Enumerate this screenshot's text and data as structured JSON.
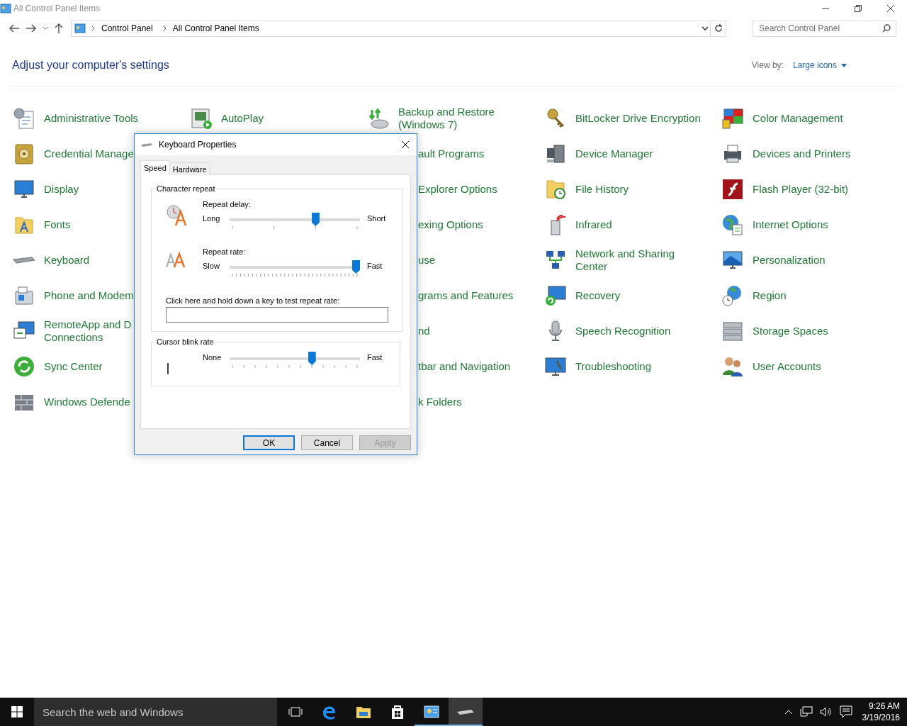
{
  "window": {
    "title": "All Control Panel Items"
  },
  "address": {
    "crumbs": [
      "Control Panel",
      "All Control Panel Items"
    ]
  },
  "search": {
    "placeholder": "Search Control Panel"
  },
  "heading": "Adjust your computer's settings",
  "view_by": {
    "label": "View by:",
    "value": "Large icons"
  },
  "columns": [
    {
      "items": [
        {
          "label": "Administrative Tools",
          "kind": "full"
        },
        {
          "label": "Credential Manage",
          "kind": "full"
        },
        {
          "label": "Display",
          "kind": "full"
        },
        {
          "label": "Fonts",
          "kind": "full"
        },
        {
          "label": "Keyboard",
          "kind": "full"
        },
        {
          "label": "Phone and Modem",
          "kind": "full"
        },
        {
          "label": "RemoteApp and D\nConnections",
          "kind": "full"
        },
        {
          "label": "Sync Center",
          "kind": "full"
        },
        {
          "label": "Windows Defende",
          "kind": "full"
        }
      ]
    },
    {
      "items": [
        {
          "label": "AutoPlay",
          "kind": "full"
        }
      ]
    },
    {
      "items": [
        {
          "label": "Backup and Restore\n(Windows 7)",
          "kind": "full"
        },
        {
          "label": "ault Programs",
          "kind": "clipped"
        },
        {
          "label": "Explorer Options",
          "kind": "clipped"
        },
        {
          "label": "exing Options",
          "kind": "clipped"
        },
        {
          "label": "use",
          "kind": "clipped"
        },
        {
          "label": "grams and Features",
          "kind": "clipped"
        },
        {
          "label": "nd",
          "kind": "clipped"
        },
        {
          "label": "tbar and Navigation",
          "kind": "clipped"
        },
        {
          "label": "k Folders",
          "kind": "clipped"
        }
      ]
    },
    {
      "items": [
        {
          "label": "BitLocker Drive Encryption",
          "kind": "full"
        },
        {
          "label": "Device Manager",
          "kind": "full"
        },
        {
          "label": "File History",
          "kind": "full"
        },
        {
          "label": "Infrared",
          "kind": "full"
        },
        {
          "label": "Network and Sharing\nCenter",
          "kind": "full"
        },
        {
          "label": "Recovery",
          "kind": "full"
        },
        {
          "label": "Speech Recognition",
          "kind": "full"
        },
        {
          "label": "Troubleshooting",
          "kind": "full"
        }
      ]
    },
    {
      "items": [
        {
          "label": "Color Management",
          "kind": "full"
        },
        {
          "label": "Devices and Printers",
          "kind": "full"
        },
        {
          "label": "Flash Player (32-bit)",
          "kind": "full"
        },
        {
          "label": "Internet Options",
          "kind": "full"
        },
        {
          "label": "Personalization",
          "kind": "full"
        },
        {
          "label": "Region",
          "kind": "full"
        },
        {
          "label": "Storage Spaces",
          "kind": "full"
        },
        {
          "label": "User Accounts",
          "kind": "full"
        }
      ]
    }
  ],
  "dialog": {
    "title": "Keyboard Properties",
    "tabs": [
      {
        "label": "Speed",
        "selected": true
      },
      {
        "label": "Hardware",
        "selected": false
      }
    ],
    "groups": [
      {
        "title": "Character repeat",
        "sliders": [
          {
            "label": "Repeat delay:",
            "min": "Long",
            "max": "Short",
            "level": 0.67
          },
          {
            "label": "Repeat rate:",
            "min": "Slow",
            "max": "Fast",
            "level": 1
          }
        ],
        "test_field": {
          "label": "Click here and hold down a key to test repeat rate:"
        }
      },
      {
        "title": "Cursor blink rate",
        "sliders": [
          {
            "min": "None",
            "max": "Fast",
            "level": 0.64
          }
        ]
      }
    ],
    "buttons": [
      {
        "label": "OK",
        "default": true,
        "disabled": false
      },
      {
        "label": "Cancel",
        "default": false,
        "disabled": false
      },
      {
        "label": "Apply",
        "default": false,
        "disabled": true
      }
    ]
  },
  "taskbar": {
    "search_placeholder": "Search the web and Windows",
    "apps": [
      {
        "running": false,
        "focused": false
      },
      {
        "running": false,
        "focused": false
      },
      {
        "running": false,
        "focused": false
      },
      {
        "running": false,
        "focused": false
      },
      {
        "running": true,
        "focused": false
      },
      {
        "running": true,
        "focused": true
      }
    ],
    "clock": {
      "time": "9:26 AM",
      "date": "3/19/2016"
    }
  }
}
